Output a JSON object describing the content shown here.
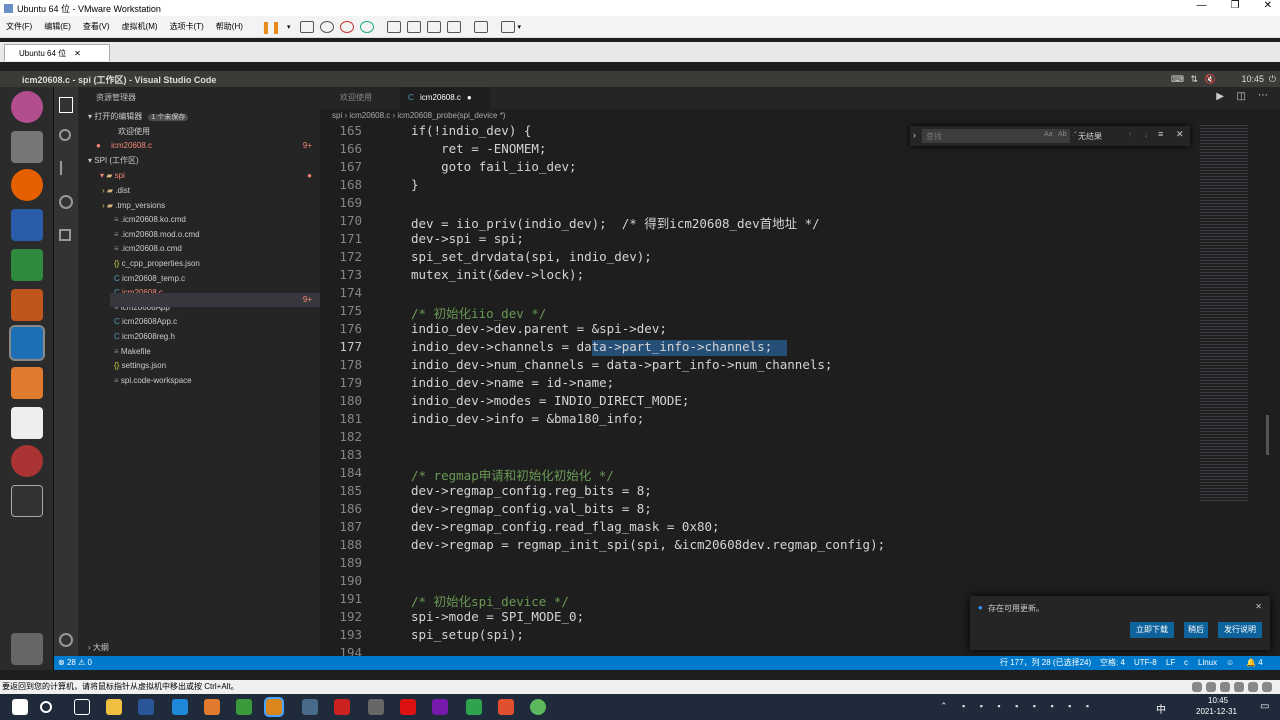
{
  "vmware": {
    "title": "Ubuntu 64 位 - VMware Workstation",
    "menu": [
      "文件(F)",
      "编辑(E)",
      "查看(V)",
      "虚拟机(M)",
      "选项卡(T)",
      "帮助(H)"
    ],
    "tab": "Ubuntu 64 位"
  },
  "ubuntu": {
    "window_title": "icm20608.c - spi (工作区) - Visual Studio Code",
    "clock": "10:45"
  },
  "vscode": {
    "sidebar": {
      "title": "资源管理器",
      "open_editors": "打开的编辑器",
      "unsaved_badge": "1 个未保存",
      "open_files": [
        "欢迎使用",
        "icm20608.c"
      ],
      "workspace": "SPI (工作区)",
      "root_folder": "spi",
      "files": [
        ".dist",
        ".tmp_versions",
        ".icm20608.ko.cmd",
        ".icm20608.mod.o.cmd",
        ".icm20608.o.cmd",
        "c_cpp_properties.json",
        "icm20608_temp.c",
        "icm20608.c",
        "icm20608App",
        "icm20608App.c",
        "icm20608reg.h",
        "Makefile",
        "settings.json",
        "spi.code-workspace"
      ],
      "outline": "大纲",
      "badge_9plus": "9+"
    },
    "tabs": [
      "欢迎使用",
      "icm20608.c"
    ],
    "breadcrumb": [
      "spi",
      "icm20608.c",
      "icm20608_probe(spi_device *)"
    ],
    "find": {
      "placeholder": "查找",
      "result": "无结果"
    },
    "line_numbers": [
      "165",
      "166",
      "167",
      "168",
      "169",
      "170",
      "171",
      "172",
      "173",
      "174",
      "175",
      "176",
      "177",
      "178",
      "179",
      "180",
      "181",
      "182",
      "183",
      "184",
      "185",
      "186",
      "187",
      "188",
      "189",
      "190",
      "191",
      "192",
      "193",
      "194"
    ],
    "code_lines": [
      "if(!indio_dev) {",
      "    ret = -ENOMEM;",
      "    goto fail_iio_dev;",
      "}",
      "",
      "dev = iio_priv(indio_dev);  /* 得到icm20608_dev首地址 */",
      "dev->spi = spi;",
      "spi_set_drvdata(spi, indio_dev);",
      "mutex_init(&dev->lock);",
      "",
      "/* 初始化iio_dev */",
      "indio_dev->dev.parent = &spi->dev;",
      "indio_dev->channels = data->part_info->channels;",
      "indio_dev->num_channels = data->part_info->num_channels;",
      "indio_dev->name = id->name;",
      "indio_dev->modes = INDIO_DIRECT_MODE;",
      "indio_dev->info = &bma180_info;",
      "",
      "",
      "/* regmap申请和初始化初始化 */",
      "dev->regmap_config.reg_bits = 8;",
      "dev->regmap_config.val_bits = 8;",
      "dev->regmap_config.read_flag_mask = 0x80;",
      "dev->regmap = regmap_init_spi(spi, &icm20608dev.regmap_config);",
      "",
      "",
      "/* 初始化spi_device */",
      "spi->mode = SPI_MODE_0;",
      "spi_setup(spi);",
      ""
    ],
    "status": {
      "problems": "28",
      "warnings": "0",
      "position": "行 177，列 28 (已选择24)",
      "spaces": "空格: 4",
      "encoding": "UTF-8",
      "eol": "LF",
      "lang": "c",
      "os": "Linux",
      "bell": "4"
    },
    "toast": {
      "message": "存在可用更新。",
      "btn1": "立即下载",
      "btn2": "稍后",
      "btn3": "发行说明"
    }
  },
  "host": {
    "status_text": "要返回到您的计算机，请将鼠标指针从虚拟机中移出或按 Ctrl+Alt。",
    "time": "10:45",
    "date": "2021-12-31",
    "ime": "中"
  },
  "colors": {
    "accent": "#007acc",
    "selection": "#264f78",
    "comment": "#6a9955"
  }
}
